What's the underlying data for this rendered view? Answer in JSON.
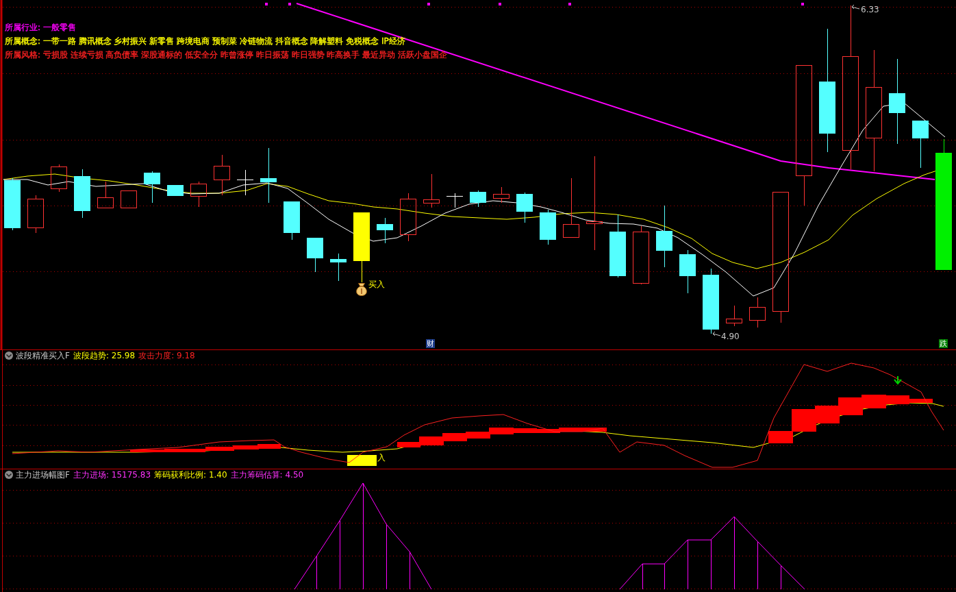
{
  "main_chart": {
    "info_lines": [
      {
        "text": "所属行业: 一般零售",
        "color": "#ff00ff"
      },
      {
        "text": "所属概念: 一带一路 腾讯概念 乡村振兴 新零售 跨境电商 预制菜 冷链物流 抖音概念 降解塑料 免税概念 IP经济",
        "color": "#ffff00"
      },
      {
        "text": "所属风格: 亏损股 连续亏损 高负债率 深股通标的 低安全分 昨曾涨停 昨日振荡 昨日强势 昨高换手 最近异动 活跃小盘国企",
        "color": "#ff2222"
      }
    ],
    "high_label": "6.33",
    "low_label": "4.90",
    "buy_label": "买入",
    "event_tags": [
      {
        "text": "财",
        "color": "#1c3c8c"
      },
      {
        "text": "跌",
        "color": "#008000"
      }
    ]
  },
  "indicator_1": {
    "title": "波段精准买入F",
    "readings": [
      {
        "text": "波段趋势: 25.98",
        "color": "#ffff00"
      },
      {
        "text": "攻击力度: 9.18",
        "color": "#ff2222"
      }
    ],
    "buy_label": "入"
  },
  "indicator_2": {
    "title": "主力进场幅图F",
    "readings": [
      {
        "text": "主力进场: 15175.83",
        "color": "#ff33ff"
      },
      {
        "text": "筹码获利比例: 1.40",
        "color": "#ffff00"
      },
      {
        "text": "主力筹码估算: 4.50",
        "color": "#ff33ff"
      }
    ]
  }
}
